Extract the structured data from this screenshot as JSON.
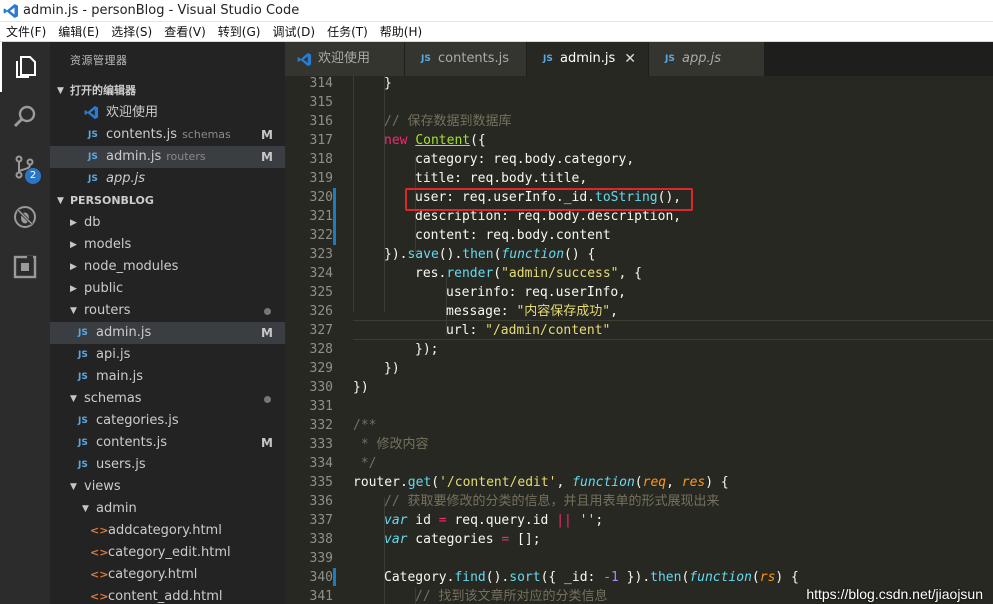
{
  "window": {
    "title": "admin.js - personBlog - Visual Studio Code"
  },
  "menu": [
    "文件(F)",
    "编辑(E)",
    "选择(S)",
    "查看(V)",
    "转到(G)",
    "调试(D)",
    "任务(T)",
    "帮助(H)"
  ],
  "activity": {
    "scm_badge": "2"
  },
  "sidebar": {
    "title": "资源管理器",
    "open_editors_label": "打开的编辑器",
    "open_editors": [
      {
        "name": "欢迎使用",
        "sub": "",
        "badge": ""
      },
      {
        "name": "contents.js",
        "sub": "schemas",
        "badge": "M"
      },
      {
        "name": "admin.js",
        "sub": "routers",
        "badge": "M"
      },
      {
        "name": "app.js",
        "sub": "",
        "badge": ""
      }
    ],
    "project_label": "PERSONBLOG",
    "tree": [
      {
        "name": "db"
      },
      {
        "name": "models"
      },
      {
        "name": "node_modules"
      },
      {
        "name": "public"
      },
      {
        "name": "routers"
      },
      {
        "name": "admin.js",
        "badge": "M"
      },
      {
        "name": "api.js"
      },
      {
        "name": "main.js"
      },
      {
        "name": "schemas"
      },
      {
        "name": "categories.js"
      },
      {
        "name": "contents.js",
        "badge": "M"
      },
      {
        "name": "users.js"
      },
      {
        "name": "views"
      },
      {
        "name": "admin"
      },
      {
        "name": "addcategory.html"
      },
      {
        "name": "category_edit.html"
      },
      {
        "name": "category.html"
      },
      {
        "name": "content_add.html"
      }
    ]
  },
  "tabs": [
    {
      "label": "欢迎使用"
    },
    {
      "label": "contents.js"
    },
    {
      "label": "admin.js"
    },
    {
      "label": "app.js"
    }
  ],
  "editor": {
    "lines": [
      "314",
      "315",
      "316",
      "317",
      "318",
      "319",
      "320",
      "321",
      "322",
      "323",
      "324",
      "325",
      "326",
      "327",
      "328",
      "329",
      "330",
      "331",
      "332",
      "333",
      "334",
      "335",
      "336",
      "337",
      "338",
      "339",
      "340",
      "341"
    ],
    "code": {
      "l314": "}",
      "l316": "// 保存数据到数据库",
      "l317_kw": "new",
      "l317_cls": "Content",
      "l317_rest": "({",
      "l318": "category: req.body.category,",
      "l319": "title: req.body.title,",
      "l320_a": "user: req.userInfo._id.",
      "l320_fn": "toString",
      "l320_b": "(),",
      "l321": "description: req.body.description,",
      "l322": "content: req.body.content",
      "l323_a": "}).",
      "l323_f1": "save",
      "l323_b": "().",
      "l323_f2": "then",
      "l323_c": "(",
      "l323_kw": "function",
      "l323_d": "() {",
      "l324_a": "res.",
      "l324_f": "render",
      "l324_b": "(",
      "l324_s": "\"admin/success\"",
      "l324_c": ", {",
      "l325": "userinfo: req.userInfo,",
      "l326_a": "message: ",
      "l326_s": "\"内容保存成功\"",
      "l326_b": ",",
      "l327_a": "url: ",
      "l327_s": "\"/admin/content\"",
      "l328": "});",
      "l329": "})",
      "l330": "})",
      "l332": "/**",
      "l333": " * 修改内容",
      "l334": " */",
      "l335_a": "router.",
      "l335_f": "get",
      "l335_b": "(",
      "l335_s": "'/content/edit'",
      "l335_c": ", ",
      "l335_kw": "function",
      "l335_d": "(",
      "l335_p1": "req",
      "l335_e": ", ",
      "l335_p2": "res",
      "l335_g": ") {",
      "l336": "// 获取要修改的分类的信息，并且用表单的形式展现出来",
      "l337_kw": "var",
      "l337_a": " id ",
      "l337_op": "=",
      "l337_b": " req.query.id ",
      "l337_or": "||",
      "l337_s": " ''",
      "l337_c": ";",
      "l338_kw": "var",
      "l338_a": " categories ",
      "l338_op": "=",
      "l338_b": " [];",
      "l340_a": "Category.",
      "l340_f1": "find",
      "l340_b": "().",
      "l340_f2": "sort",
      "l340_c": "({ _id: ",
      "l340_n": "-1",
      "l340_d": " }).",
      "l340_f3": "then",
      "l340_e": "(",
      "l340_kw": "function",
      "l340_g": "(",
      "l340_p": "rs",
      "l340_h": ") {",
      "l341": "// 找到该文章所对应的分类信息"
    }
  },
  "watermark": "https://blog.csdn.net/jiaojsun"
}
